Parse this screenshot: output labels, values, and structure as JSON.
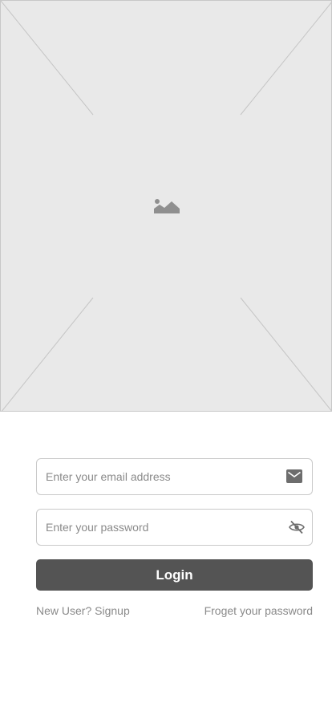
{
  "hero": {
    "icon": "image-placeholder-icon"
  },
  "login_form": {
    "email": {
      "placeholder": "Enter your email address",
      "value": "",
      "icon": "mail-icon"
    },
    "password": {
      "placeholder": "Enter your password",
      "value": "",
      "icon": "eye-off-icon"
    },
    "login_label": "Login",
    "signup_link": "New User? Signup",
    "forgot_link": "Froget your password"
  },
  "colors": {
    "button_bg": "#545454",
    "placeholder_bg": "#e9e9e9",
    "field_border": "#c9c9c9",
    "muted_text": "#8a8a8a"
  }
}
